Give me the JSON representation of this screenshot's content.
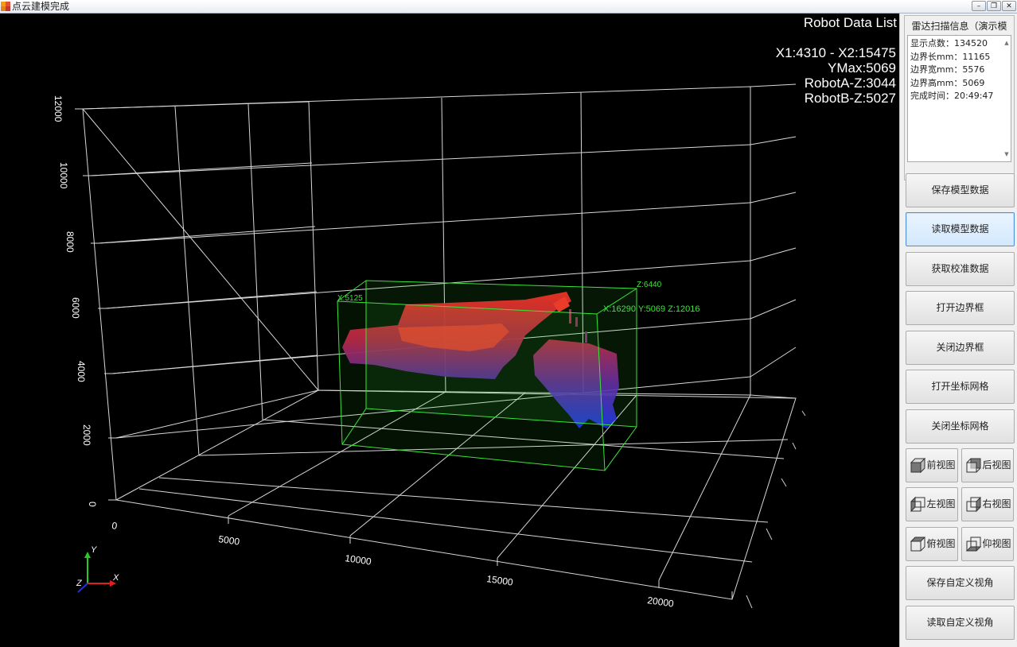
{
  "window": {
    "title": "点云建模完成",
    "minimize": "–",
    "restore": "❐",
    "close": "✕"
  },
  "viewport": {
    "overlay_title": "Robot Data List",
    "overlay_lines": [
      "X1:4310 - X2:15475",
      "YMax:5069",
      "RobotA-Z:3044",
      "RobotB-Z:5027"
    ],
    "y_ticks": [
      "0",
      "2000",
      "4000",
      "6000",
      "8000",
      "10000",
      "12000"
    ],
    "x_ticks": [
      "0",
      "5000",
      "10000",
      "15000",
      "20000"
    ],
    "bbox_labels": {
      "left": "X:5125",
      "top_right": "Z:6440",
      "corner": "X:16290 Y:5069 Z:12016"
    },
    "axis_labels": {
      "x": "X",
      "y": "Y",
      "z": "Z"
    },
    "colors": {
      "grid": "#d8d8d8",
      "bbox": "#39e639",
      "points_high": "#ff1a1a",
      "points_low": "#1a1aff"
    }
  },
  "panel": {
    "group_title": "雷达扫描信息（演示模式）",
    "info": [
      "显示点数：134520",
      "边界长mm：11165",
      "边界宽mm：5576",
      "边界高mm：5069",
      "完成时间：20:49:47"
    ],
    "buttons": {
      "save_model": "保存模型数据",
      "load_model": "读取模型数据",
      "get_calib": "获取校准数据",
      "open_bbox": "打开边界框",
      "close_bbox": "关闭边界框",
      "open_grid": "打开坐标网格",
      "close_grid": "关闭坐标网格",
      "front_view": "前视图",
      "back_view": "后视图",
      "left_view": "左视图",
      "right_view": "右视图",
      "top_view": "俯视图",
      "bottom_view": "仰视图",
      "save_custom_view": "保存自定义视角",
      "load_custom_view": "读取自定义视角"
    }
  }
}
